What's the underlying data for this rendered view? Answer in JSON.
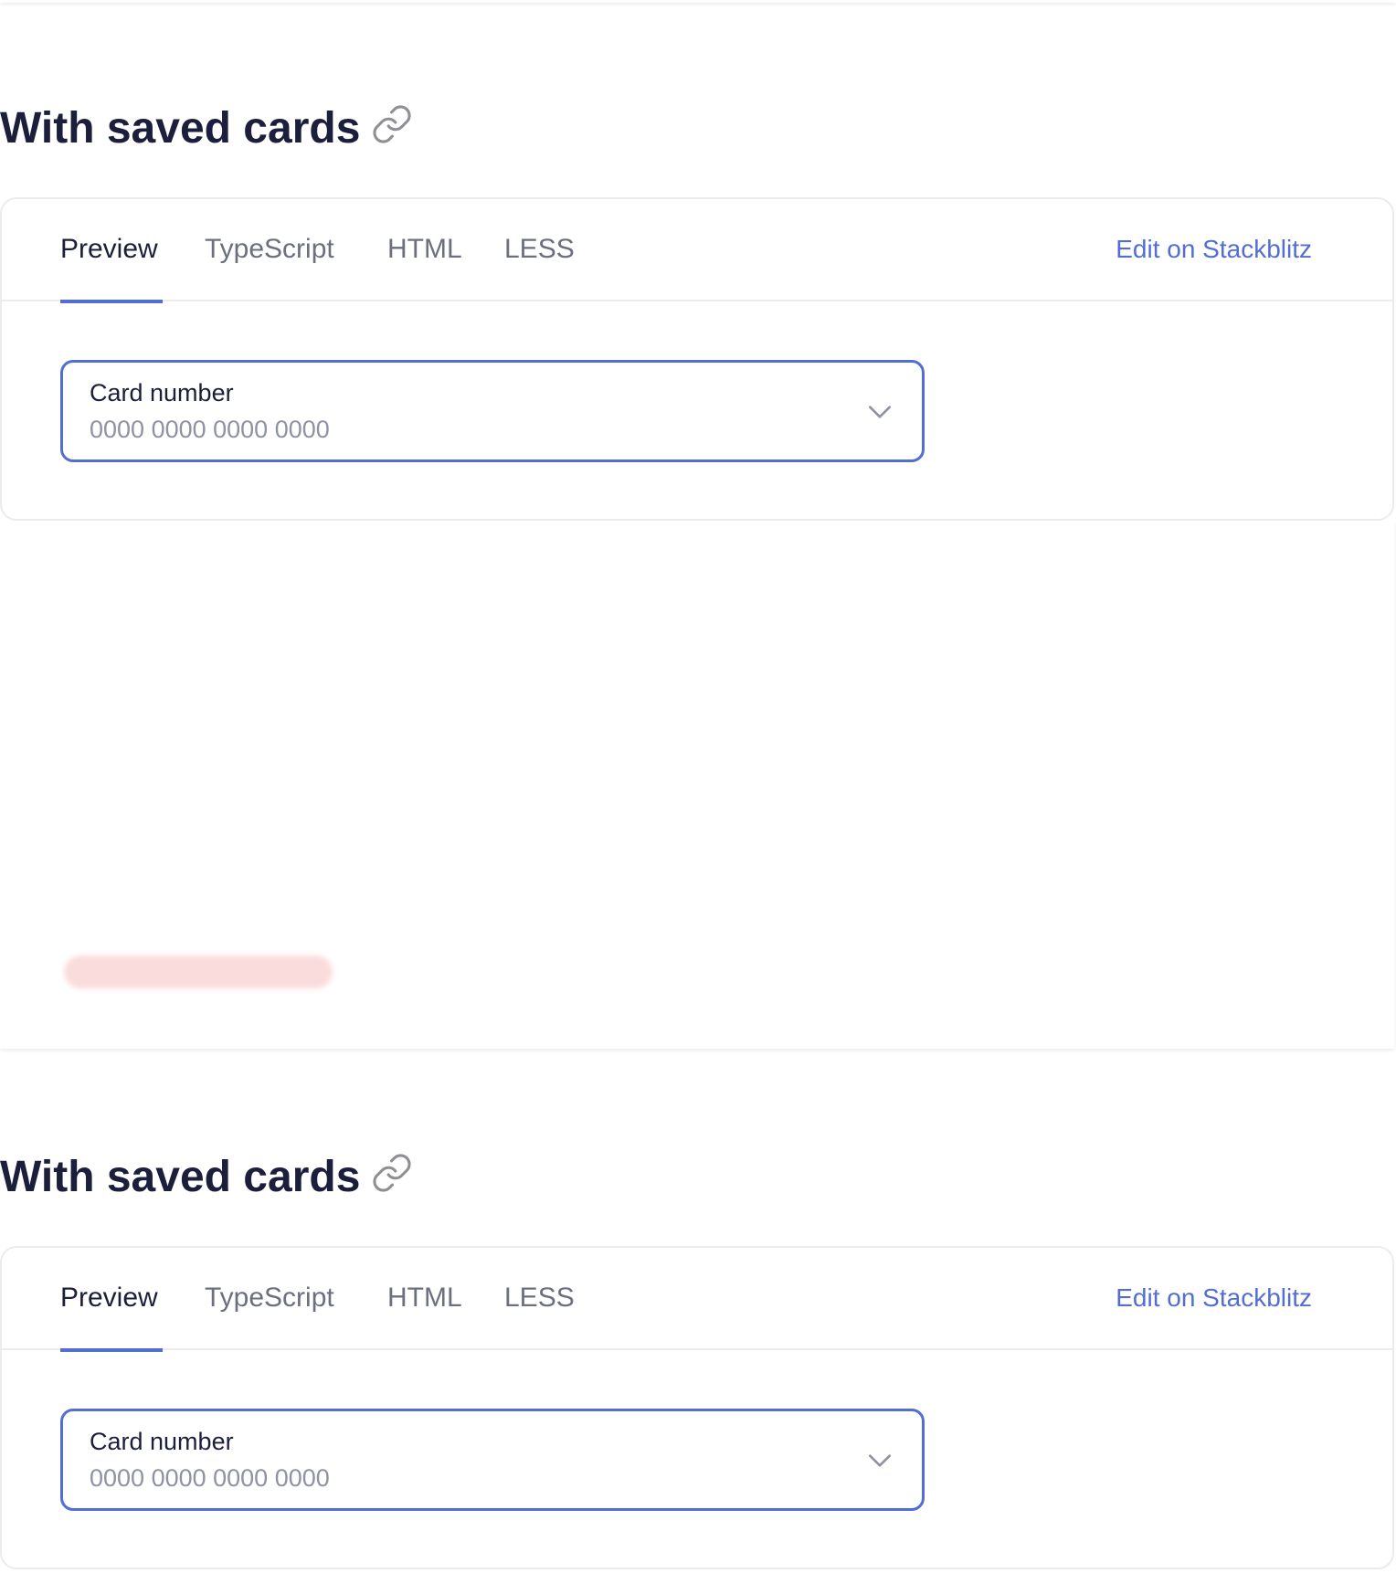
{
  "sections": [
    {
      "title": "With saved cards",
      "tabs": {
        "preview": "Preview",
        "typescript": "TypeScript",
        "html": "HTML",
        "less": "LESS"
      },
      "stackblitz_label": "Edit on Stackblitz",
      "field": {
        "label": "Card number",
        "placeholder": "0000 0000 0000 0000"
      }
    },
    {
      "title": "With saved cards",
      "tabs": {
        "preview": "Preview",
        "typescript": "TypeScript",
        "html": "HTML",
        "less": "LESS"
      },
      "stackblitz_label": "Edit on Stackblitz",
      "field": {
        "label": "Card number",
        "placeholder": "0000 0000 0000 0000"
      }
    }
  ],
  "icons": {
    "anchor": "link-icon",
    "dropdown": "chevron-down-icon"
  },
  "colors": {
    "accent": "#526ed3",
    "title": "#1b1f3b",
    "muted": "#6b6f80",
    "placeholder": "#8e92a2",
    "border": "#ebebf0"
  }
}
